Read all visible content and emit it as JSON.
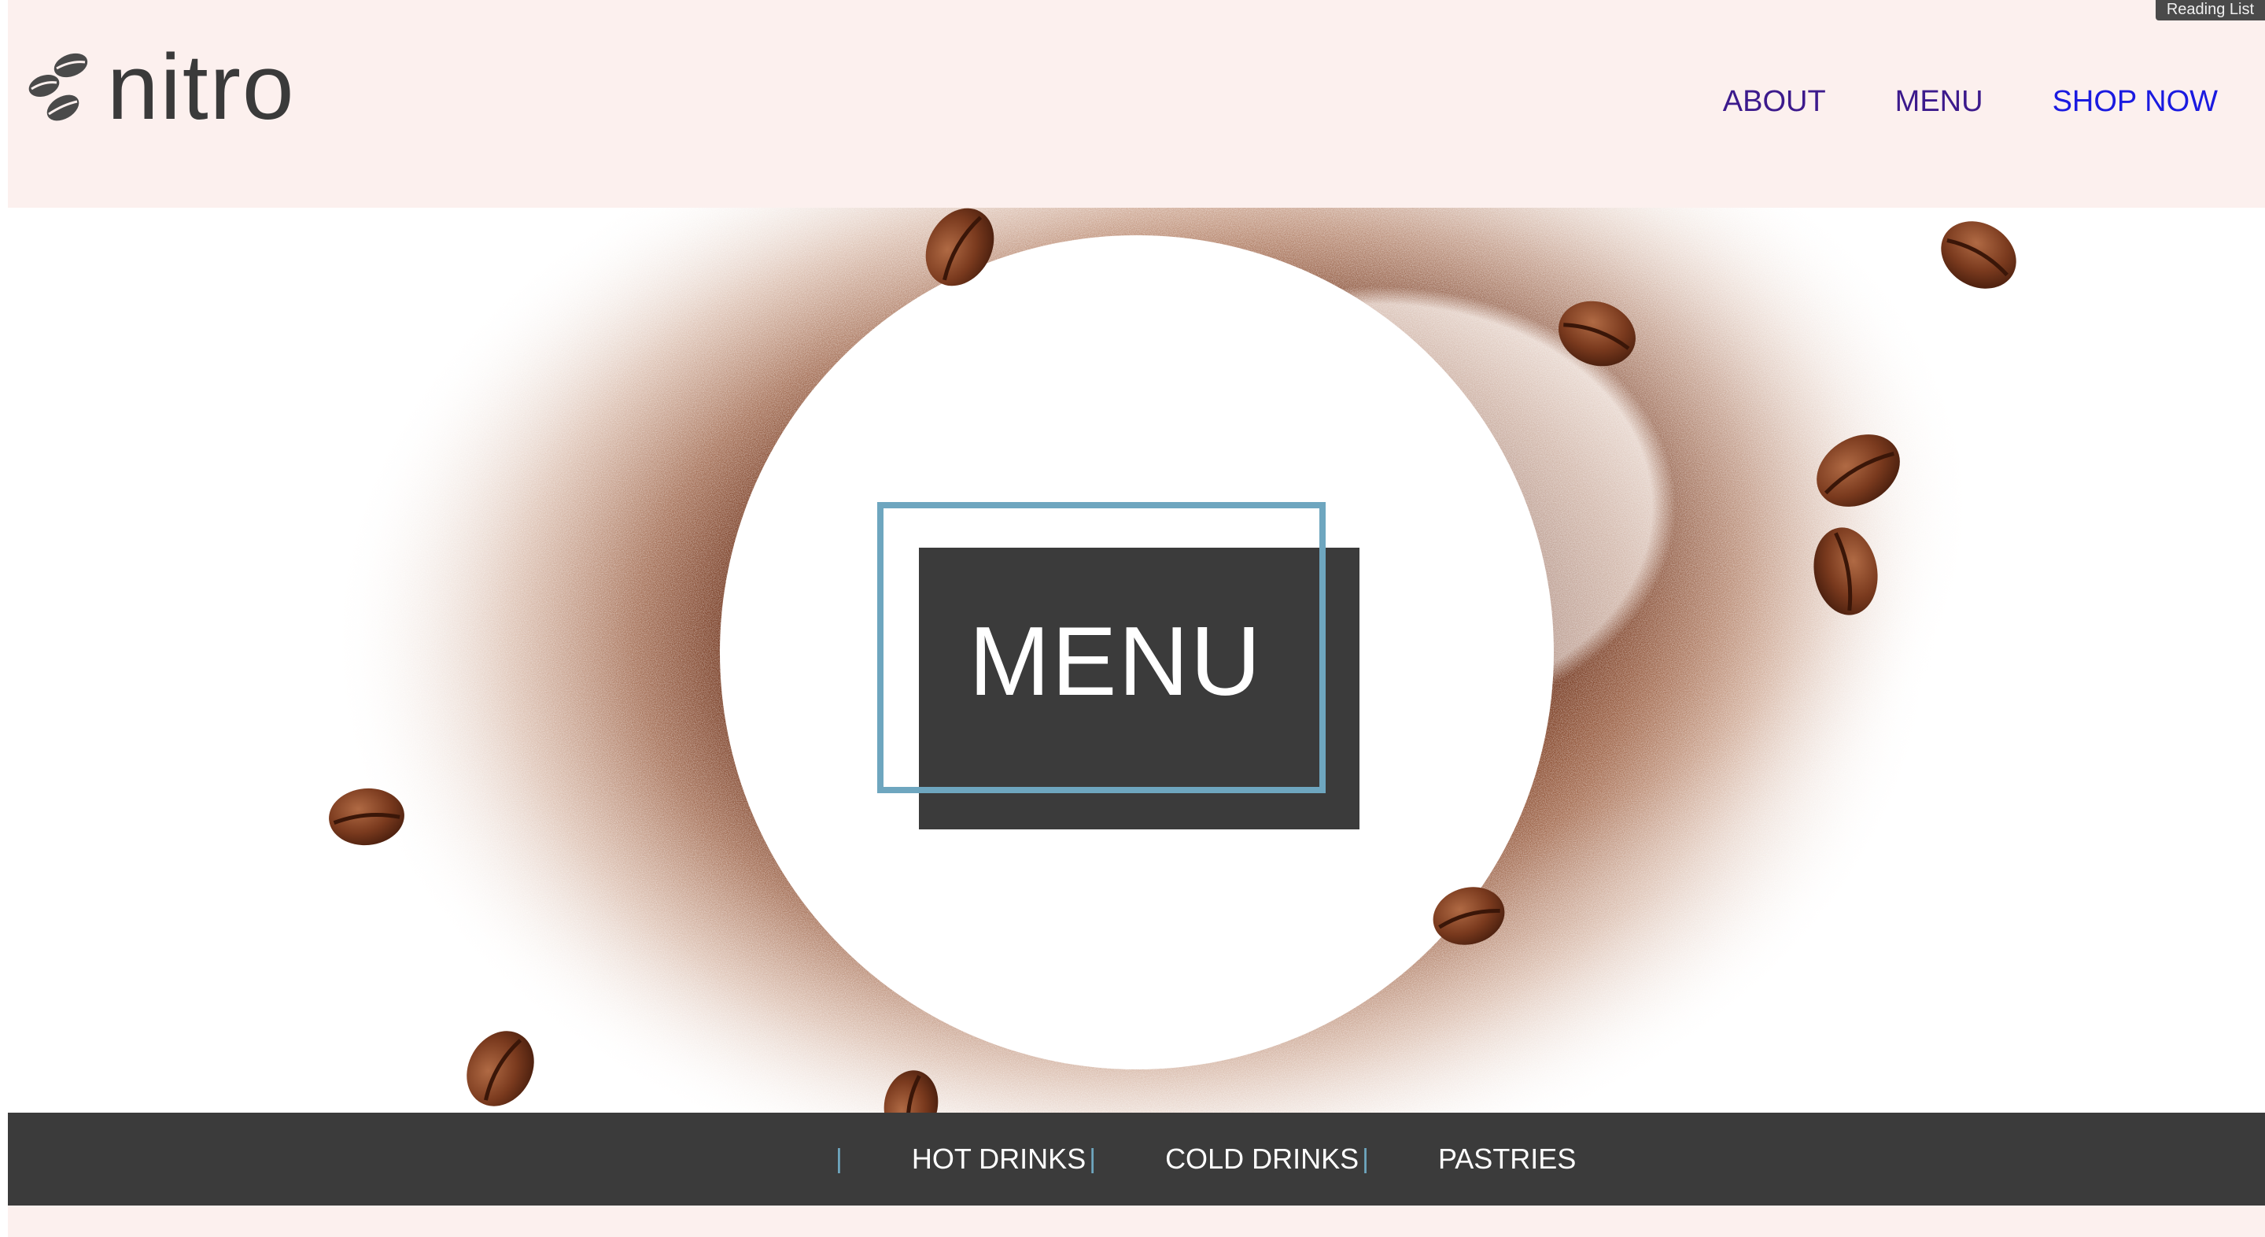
{
  "browser": {
    "reading_list_label": "Reading List"
  },
  "header": {
    "logo_text": "nitro",
    "logo_icon": "coffee-beans-icon",
    "nav": [
      {
        "label": "ABOUT"
      },
      {
        "label": "MENU"
      },
      {
        "label": "SHOP NOW"
      }
    ]
  },
  "hero": {
    "title": "MENU",
    "background": "coffee-grounds-circle-with-beans"
  },
  "categories": {
    "separator": "|",
    "items": [
      {
        "label": "HOT DRINKS"
      },
      {
        "label": "COLD DRINKS"
      },
      {
        "label": "PASTRIES"
      }
    ]
  },
  "colors": {
    "header_bg": "#fcf0ee",
    "nav_link": "#3c1a8c",
    "shop_link": "#1a1ae0",
    "dark_panel": "#3b3b3b",
    "accent_blue": "#6ea6bf",
    "coffee_brown": "#7a3a1e"
  }
}
